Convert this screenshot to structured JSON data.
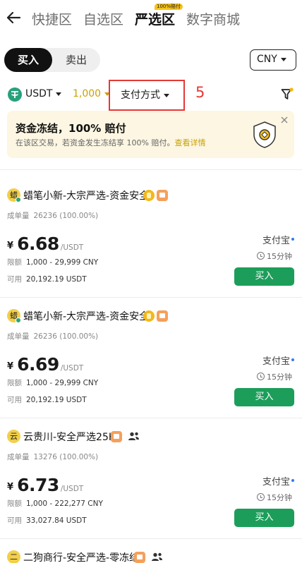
{
  "header": {
    "tabs": [
      "快捷区",
      "自选区",
      "严选区",
      "数字商城"
    ],
    "active_tab": "严选区",
    "badge": "100%赔付"
  },
  "trade": {
    "buy_label": "买入",
    "sell_label": "卖出",
    "currency": "CNY"
  },
  "filters": {
    "asset": "USDT",
    "amount": "1,000",
    "payment": "支付方式",
    "annotation": "5"
  },
  "banner": {
    "title": "资金冻结，100% 赔付",
    "text": "在该区交易，若资金发生冻结享 100% 赔付。",
    "link": "查看详情"
  },
  "labels": {
    "orders": "成单量",
    "limit": "限额",
    "available": "可用",
    "per_unit": "/USDT",
    "yen": "¥"
  },
  "offers": [
    {
      "avatar": "蜡",
      "merchant": "蜡笔小新-大宗严选-资金安全",
      "orders": "26236 (100.00%)",
      "price": "6.68",
      "limit": "1,000 - 29,999 CNY",
      "available": "20,192.19 USDT",
      "payment": "支付宝",
      "time": "15分钟",
      "button": "买入"
    },
    {
      "avatar": "蜡",
      "merchant": "蜡笔小新-大宗严选-资金安全",
      "orders": "26236 (100.00%)",
      "price": "6.69",
      "limit": "1,000 - 29,999 CNY",
      "available": "20,192.19 USDT",
      "payment": "支付宝",
      "time": "15分钟",
      "button": "买入"
    },
    {
      "avatar": "云",
      "merchant": "云贵川-安全严选25H",
      "orders": "13276 (100.00%)",
      "price": "6.73",
      "limit": "1,000 - 222,277 CNY",
      "available": "33,027.84 USDT",
      "payment": "支付宝",
      "time": "15分钟",
      "button": "买入"
    },
    {
      "avatar": "二",
      "merchant": "二狗商行-安全严选-零冻结"
    }
  ],
  "colors": {
    "accent_green": "#1c9e5a",
    "brand_yellow": "#f7c21a",
    "annotation_red": "#e53935"
  }
}
